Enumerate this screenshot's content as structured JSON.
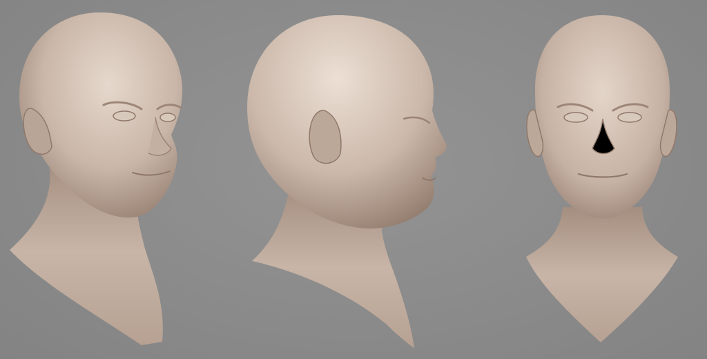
{
  "scene": {
    "background_color": "#8c8c8c",
    "material_color": "#c9b6a8",
    "material_shadow_color": "#8f786a",
    "material_highlight_color": "#e6d8cc",
    "views": [
      {
        "name": "three-quarter-view"
      },
      {
        "name": "side-profile-view"
      },
      {
        "name": "front-view"
      }
    ]
  }
}
